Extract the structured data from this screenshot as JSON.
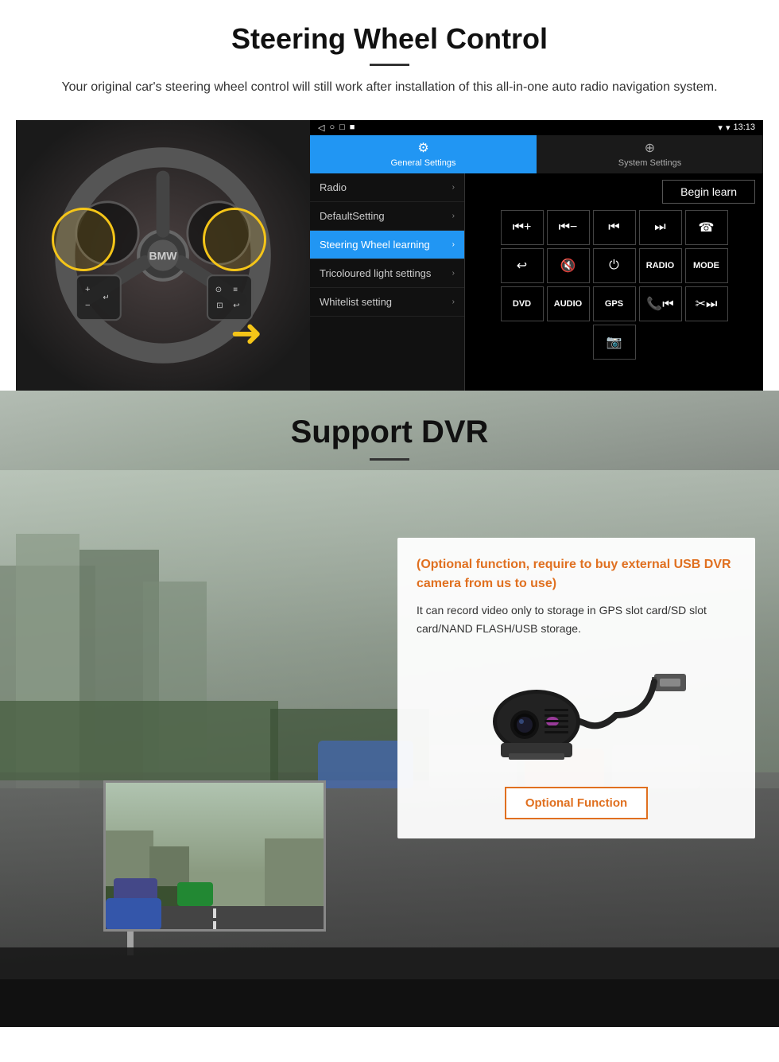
{
  "steering": {
    "title": "Steering Wheel Control",
    "subtitle": "Your original car's steering wheel control will still work after installation of this all-in-one auto radio navigation system.",
    "tabs": [
      {
        "label": "General Settings",
        "active": true
      },
      {
        "label": "System Settings",
        "active": false
      }
    ],
    "menu_items": [
      {
        "label": "Radio",
        "active": false
      },
      {
        "label": "DefaultSetting",
        "active": false
      },
      {
        "label": "Steering Wheel learning",
        "active": true
      },
      {
        "label": "Tricoloured light settings",
        "active": false
      },
      {
        "label": "Whitelist setting",
        "active": false
      }
    ],
    "begin_learn_label": "Begin learn",
    "statusbar": {
      "time": "13:13",
      "nav_icons": [
        "◁",
        "○",
        "□",
        "■"
      ]
    },
    "control_buttons": [
      [
        "vol+",
        "vol-",
        "⏮",
        "⏭",
        "☎"
      ],
      [
        "↩",
        "🔇",
        "⏻",
        "RADIO",
        "MODE"
      ],
      [
        "DVD",
        "AUDIO",
        "GPS",
        "📞⏮",
        "✂⏭"
      ],
      [
        "📷"
      ]
    ]
  },
  "dvr": {
    "title": "Support DVR",
    "optional_text": "(Optional function, require to buy external USB DVR camera from us to use)",
    "desc_text": "It can record video only to storage in GPS slot card/SD slot card/NAND FLASH/USB storage.",
    "optional_function_btn": "Optional Function"
  }
}
